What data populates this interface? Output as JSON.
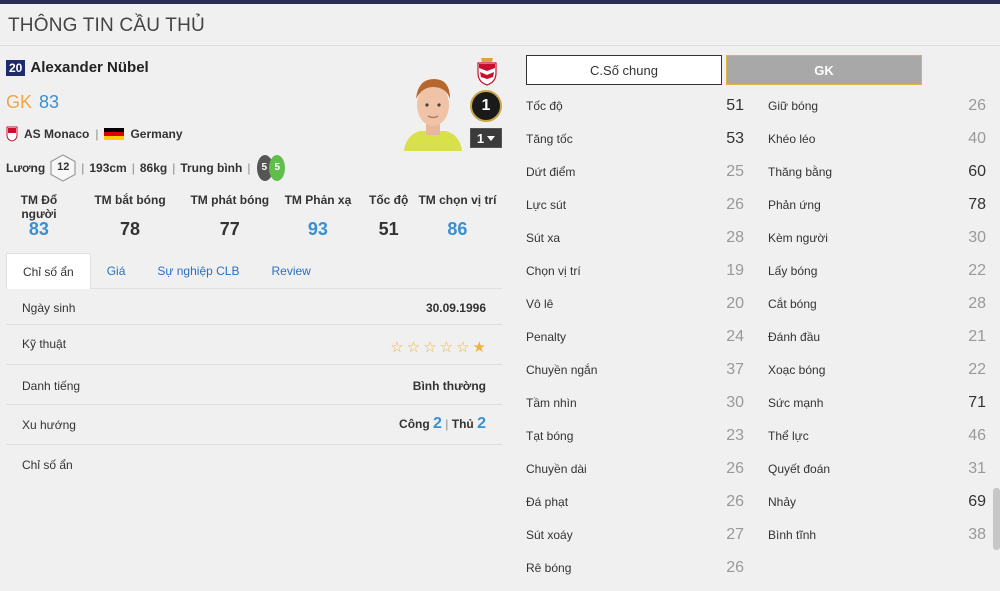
{
  "page_title": "THÔNG TIN CẦU THỦ",
  "player": {
    "number": "20",
    "name": "Alexander Nübel",
    "position": "GK",
    "overall": "83",
    "club": "AS Monaco",
    "nation": "Germany",
    "salary_label": "Lương",
    "salary": "12",
    "height": "193cm",
    "weight": "86kg",
    "body_type": "Trung bình",
    "weak_foot": "5",
    "strong_foot": "5",
    "level": "1",
    "level_select": "1",
    "separator": "|"
  },
  "key_attrs": [
    {
      "label": "TM Đổ người",
      "value": "83",
      "color": "blue"
    },
    {
      "label": "TM bắt bóng",
      "value": "78",
      "color": "dark"
    },
    {
      "label": "TM phát bóng",
      "value": "77",
      "color": "dark"
    },
    {
      "label": "TM Phản xạ",
      "value": "93",
      "color": "blue"
    },
    {
      "label": "Tốc độ",
      "value": "51",
      "color": "dark"
    },
    {
      "label": "TM chọn vị trí",
      "value": "86",
      "color": "blue"
    }
  ],
  "tabs": [
    "Chỉ số ẩn",
    "Giá",
    "Sự nghiệp CLB",
    "Review"
  ],
  "info": {
    "dob_label": "Ngày sinh",
    "dob": "30.09.1996",
    "skill_label": "Kỹ thuật",
    "skill_stars": 1,
    "skill_max": 6,
    "reputation_label": "Danh tiếng",
    "reputation": "Bình thường",
    "tendency_label": "Xu hướng",
    "attack_label": "Công",
    "attack": "2",
    "defense_label": "Thủ",
    "defense": "2",
    "hidden_label": "Chỉ số ẩn"
  },
  "view_buttons": {
    "general": "C.Số chung",
    "gk": "GK"
  },
  "stats_left": [
    {
      "label": "Tốc độ",
      "value": "51",
      "hi": true
    },
    {
      "label": "Tăng tốc",
      "value": "53",
      "hi": true
    },
    {
      "label": "Dứt điểm",
      "value": "25",
      "hi": false
    },
    {
      "label": "Lực sút",
      "value": "26",
      "hi": false
    },
    {
      "label": "Sút xa",
      "value": "28",
      "hi": false
    },
    {
      "label": "Chọn vị trí",
      "value": "19",
      "hi": false
    },
    {
      "label": "Vô lê",
      "value": "20",
      "hi": false
    },
    {
      "label": "Penalty",
      "value": "24",
      "hi": false
    },
    {
      "label": "Chuyền ngắn",
      "value": "37",
      "hi": false
    },
    {
      "label": "Tầm nhìn",
      "value": "30",
      "hi": false
    },
    {
      "label": "Tạt bóng",
      "value": "23",
      "hi": false
    },
    {
      "label": "Chuyền dài",
      "value": "26",
      "hi": false
    },
    {
      "label": "Đá phạt",
      "value": "26",
      "hi": false
    },
    {
      "label": "Sút xoáy",
      "value": "27",
      "hi": false
    },
    {
      "label": "Rê bóng",
      "value": "26",
      "hi": false
    }
  ],
  "stats_right": [
    {
      "label": "Giữ bóng",
      "value": "26",
      "hi": false
    },
    {
      "label": "Khéo léo",
      "value": "40",
      "hi": false
    },
    {
      "label": "Thăng bằng",
      "value": "60",
      "hi": true
    },
    {
      "label": "Phản ứng",
      "value": "78",
      "hi": true
    },
    {
      "label": "Kèm người",
      "value": "30",
      "hi": false
    },
    {
      "label": "Lấy bóng",
      "value": "22",
      "hi": false
    },
    {
      "label": "Cắt bóng",
      "value": "28",
      "hi": false
    },
    {
      "label": "Đánh đầu",
      "value": "21",
      "hi": false
    },
    {
      "label": "Xoạc bóng",
      "value": "22",
      "hi": false
    },
    {
      "label": "Sức mạnh",
      "value": "71",
      "hi": true
    },
    {
      "label": "Thể lực",
      "value": "46",
      "hi": false
    },
    {
      "label": "Quyết đoán",
      "value": "31",
      "hi": false
    },
    {
      "label": "Nhảy",
      "value": "69",
      "hi": true
    },
    {
      "label": "Bình tĩnh",
      "value": "38",
      "hi": false
    }
  ],
  "colors": {
    "accent_blue": "#3a8fd1",
    "gold": "#f0a646",
    "header_bar": "#2b2b55",
    "star": "#f0b43c"
  }
}
